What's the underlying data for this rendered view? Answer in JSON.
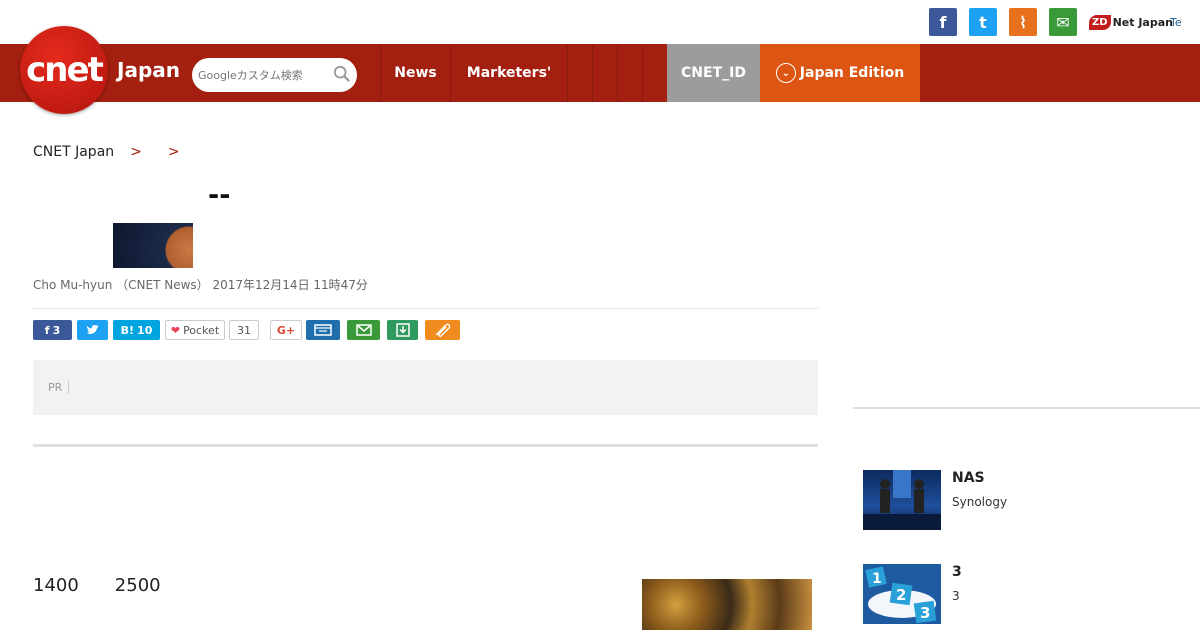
{
  "topbar": {
    "social": {
      "facebook": "f",
      "twitter": "t",
      "rss": "⌇",
      "mail": "✉"
    },
    "zdnet_mark": "ZD",
    "zdnet_label": "Net Japan",
    "techrepublic_label": "Te"
  },
  "header": {
    "logo_text": "cnet",
    "logo_region": "Japan",
    "search_placeholder": "Googleカスタム検索",
    "nav": {
      "news": "News",
      "marketers": "Marketers'",
      "extra1": "",
      "extra2": "",
      "extra3": "",
      "extra4": "",
      "cnet_id": "CNET_ID",
      "edition": "Japan Edition"
    }
  },
  "breadcrumb": {
    "home": "CNET Japan",
    "sep": ">",
    "level2": "",
    "level3": ""
  },
  "article": {
    "title": "--",
    "byline": "Cho Mu-hyun （CNET News）  2017年12月14日 11時47分",
    "pr_tag": "PR",
    "pr_text": "",
    "para1": "",
    "para2": "",
    "para3": "1400　　2500"
  },
  "share": {
    "facebook_count": "3",
    "hatena_label": "B!",
    "hatena_count": "10",
    "pocket_label": "Pocket",
    "pocket_count": "31",
    "gplus_label": "G+"
  },
  "sidebar": {
    "heading": "",
    "items": [
      {
        "title": "NAS",
        "desc_line1": "",
        "desc_line2": "Synology"
      },
      {
        "title": "3",
        "desc_line1": "",
        "desc_line2": "3"
      }
    ]
  },
  "colors": {
    "header_red": "#a32010",
    "cnet_id_gray": "#9c9c9c",
    "edition_orange": "#dc5512"
  }
}
